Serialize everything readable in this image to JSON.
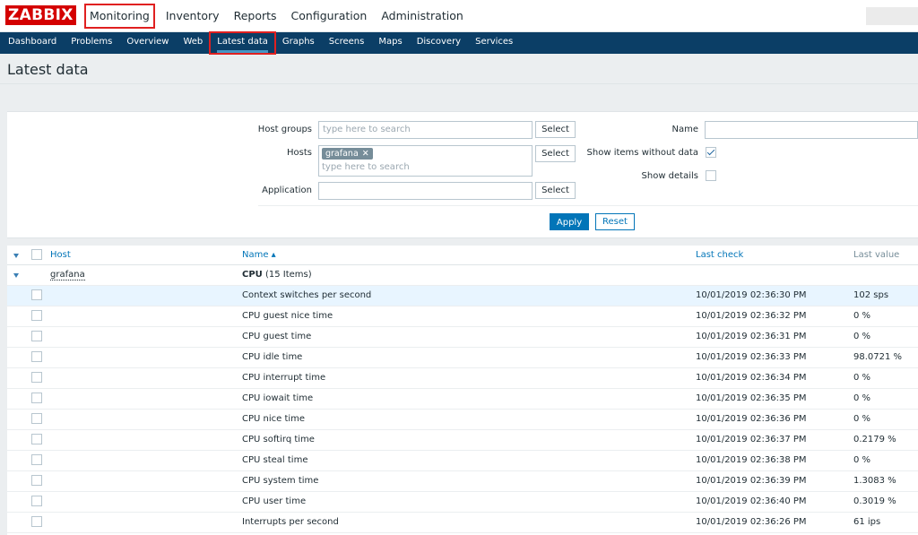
{
  "app": {
    "logo": "ZABBIX"
  },
  "mainnav": [
    {
      "label": "Monitoring"
    },
    {
      "label": "Inventory"
    },
    {
      "label": "Reports"
    },
    {
      "label": "Configuration"
    },
    {
      "label": "Administration"
    }
  ],
  "subnav": [
    {
      "label": "Dashboard"
    },
    {
      "label": "Problems"
    },
    {
      "label": "Overview"
    },
    {
      "label": "Web"
    },
    {
      "label": "Latest data"
    },
    {
      "label": "Graphs"
    },
    {
      "label": "Screens"
    },
    {
      "label": "Maps"
    },
    {
      "label": "Discovery"
    },
    {
      "label": "Services"
    }
  ],
  "page": {
    "title": "Latest data"
  },
  "filter": {
    "host_groups_label": "Host groups",
    "host_groups_placeholder": "type here to search",
    "hosts_label": "Hosts",
    "hosts_tag": "grafana",
    "hosts_placeholder": "type here to search",
    "application_label": "Application",
    "select_label": "Select",
    "name_label": "Name",
    "show_items_label": "Show items without data",
    "show_items_checked": true,
    "show_details_label": "Show details",
    "show_details_checked": false,
    "apply_label": "Apply",
    "reset_label": "Reset"
  },
  "table": {
    "headers": {
      "host": "Host",
      "name": "Name ▴",
      "last_check": "Last check",
      "last_value": "Last value"
    },
    "group": {
      "host": "grafana",
      "app_name": "CPU",
      "app_count": "(15 Items)"
    },
    "rows": [
      {
        "name": "Context switches per second",
        "last_check": "10/01/2019 02:36:30 PM",
        "last_value": "102 sps"
      },
      {
        "name": "CPU guest nice time",
        "last_check": "10/01/2019 02:36:32 PM",
        "last_value": "0 %"
      },
      {
        "name": "CPU guest time",
        "last_check": "10/01/2019 02:36:31 PM",
        "last_value": "0 %"
      },
      {
        "name": "CPU idle time",
        "last_check": "10/01/2019 02:36:33 PM",
        "last_value": "98.0721 %"
      },
      {
        "name": "CPU interrupt time",
        "last_check": "10/01/2019 02:36:34 PM",
        "last_value": "0 %"
      },
      {
        "name": "CPU iowait time",
        "last_check": "10/01/2019 02:36:35 PM",
        "last_value": "0 %"
      },
      {
        "name": "CPU nice time",
        "last_check": "10/01/2019 02:36:36 PM",
        "last_value": "0 %"
      },
      {
        "name": "CPU softirq time",
        "last_check": "10/01/2019 02:36:37 PM",
        "last_value": "0.2179 %"
      },
      {
        "name": "CPU steal time",
        "last_check": "10/01/2019 02:36:38 PM",
        "last_value": "0 %"
      },
      {
        "name": "CPU system time",
        "last_check": "10/01/2019 02:36:39 PM",
        "last_value": "1.3083 %"
      },
      {
        "name": "CPU user time",
        "last_check": "10/01/2019 02:36:40 PM",
        "last_value": "0.3019 %"
      },
      {
        "name": "Interrupts per second",
        "last_check": "10/01/2019 02:36:26 PM",
        "last_value": "61 ips"
      }
    ]
  }
}
